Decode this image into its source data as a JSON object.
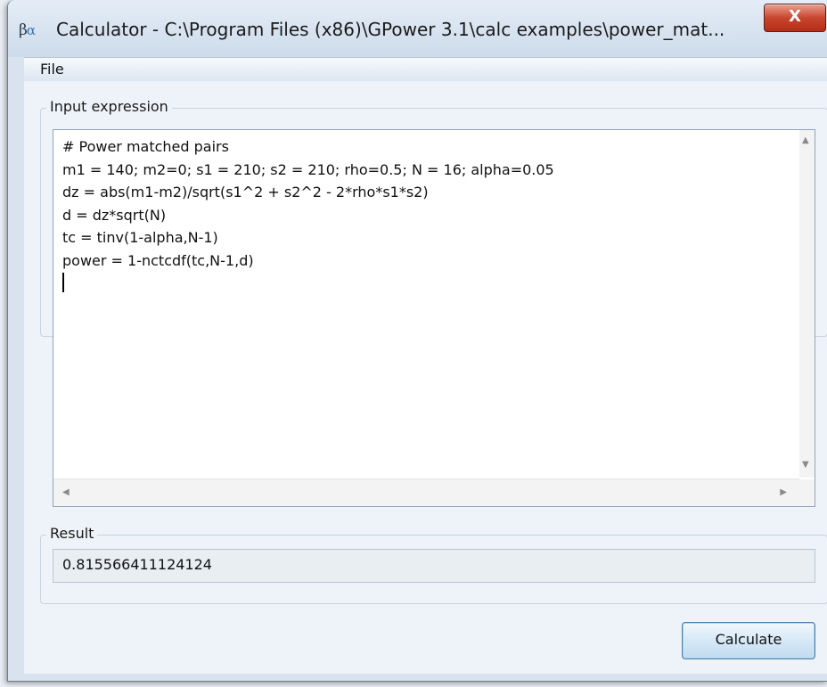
{
  "window": {
    "title": "Calculator - C:\\Program Files (x86)\\GPower 3.1\\calc examples\\power_mat...",
    "icon_glyph_beta": "β",
    "icon_glyph_alpha": "α",
    "close_glyph": "X"
  },
  "menu": {
    "file_label": "File"
  },
  "input_group": {
    "label": "Input expression",
    "code": "# Power matched pairs\nm1 = 140; m2=0; s1 = 210; s2 = 210; rho=0.5; N = 16; alpha=0.05\ndz = abs(m1-m2)/sqrt(s1^2 + s2^2 - 2*rho*s1*s2)\nd = dz*sqrt(N)\ntc = tinv(1-alpha,N-1)\npower = 1-nctcdf(tc,N-1,d)"
  },
  "result_group": {
    "label": "Result",
    "value": "0.815566411124124"
  },
  "actions": {
    "calculate_label": "Calculate"
  },
  "glyphs": {
    "up_arrow": "▲",
    "down_arrow": "▼",
    "left_arrow": "◀",
    "right_arrow": "▶"
  },
  "colors": {
    "close_button": "#c8462e",
    "calculate_border": "#4d7fa8",
    "editor_border": "#8ea4bd"
  }
}
